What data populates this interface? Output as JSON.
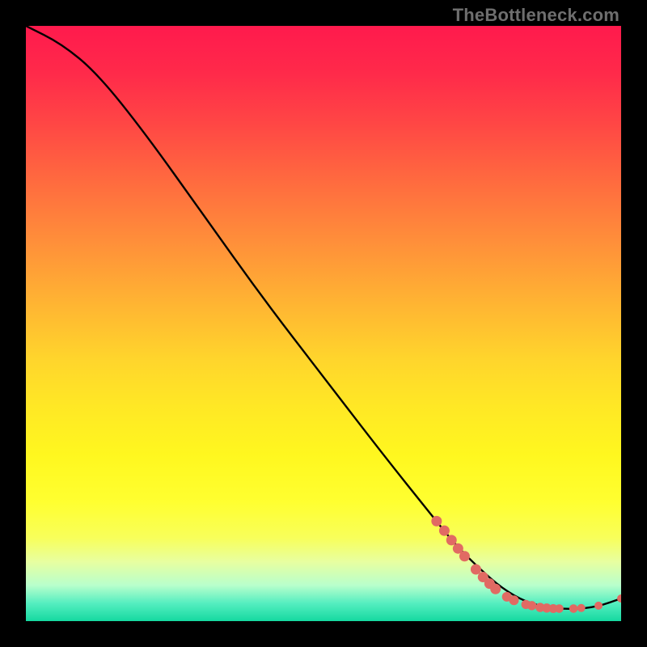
{
  "watermark": "TheBottleneck.com",
  "chart_data": {
    "type": "line",
    "title": "",
    "xlabel": "",
    "ylabel": "",
    "xlim": [
      0,
      100
    ],
    "ylim": [
      0,
      100
    ],
    "grid": false,
    "curve": [
      {
        "x": 0,
        "y": 100
      },
      {
        "x": 6,
        "y": 97
      },
      {
        "x": 12,
        "y": 92
      },
      {
        "x": 20,
        "y": 82
      },
      {
        "x": 30,
        "y": 68
      },
      {
        "x": 40,
        "y": 54
      },
      {
        "x": 50,
        "y": 41
      },
      {
        "x": 60,
        "y": 28
      },
      {
        "x": 68,
        "y": 18
      },
      {
        "x": 72,
        "y": 13
      },
      {
        "x": 76,
        "y": 9
      },
      {
        "x": 80,
        "y": 5.5
      },
      {
        "x": 84,
        "y": 3.2
      },
      {
        "x": 88,
        "y": 2.2
      },
      {
        "x": 92,
        "y": 2.0
      },
      {
        "x": 96,
        "y": 2.4
      },
      {
        "x": 100,
        "y": 3.8
      }
    ],
    "markers": [
      {
        "x": 69.0,
        "y": 16.8,
        "r": 6.5
      },
      {
        "x": 70.3,
        "y": 15.2,
        "r": 6.5
      },
      {
        "x": 71.5,
        "y": 13.6,
        "r": 6.5
      },
      {
        "x": 72.6,
        "y": 12.2,
        "r": 6.5
      },
      {
        "x": 73.7,
        "y": 10.9,
        "r": 6.5
      },
      {
        "x": 75.6,
        "y": 8.7,
        "r": 6.5
      },
      {
        "x": 76.8,
        "y": 7.4,
        "r": 6.5
      },
      {
        "x": 77.9,
        "y": 6.3,
        "r": 6.5
      },
      {
        "x": 78.9,
        "y": 5.4,
        "r": 6.5
      },
      {
        "x": 80.8,
        "y": 4.1,
        "r": 6.0
      },
      {
        "x": 82.0,
        "y": 3.5,
        "r": 6.0
      },
      {
        "x": 84.0,
        "y": 2.8,
        "r": 5.7
      },
      {
        "x": 85.0,
        "y": 2.6,
        "r": 5.7
      },
      {
        "x": 86.4,
        "y": 2.3,
        "r": 5.7
      },
      {
        "x": 87.5,
        "y": 2.2,
        "r": 5.7
      },
      {
        "x": 88.6,
        "y": 2.1,
        "r": 5.5
      },
      {
        "x": 89.6,
        "y": 2.1,
        "r": 5.3
      },
      {
        "x": 92.0,
        "y": 2.1,
        "r": 5.3
      },
      {
        "x": 93.3,
        "y": 2.2,
        "r": 5.0
      },
      {
        "x": 96.2,
        "y": 2.6,
        "r": 5.0
      },
      {
        "x": 100.0,
        "y": 3.8,
        "r": 5.0
      }
    ],
    "colors": {
      "curve": "#000000",
      "marker_fill": "#e16a63",
      "marker_stroke": "#e16a63"
    }
  }
}
